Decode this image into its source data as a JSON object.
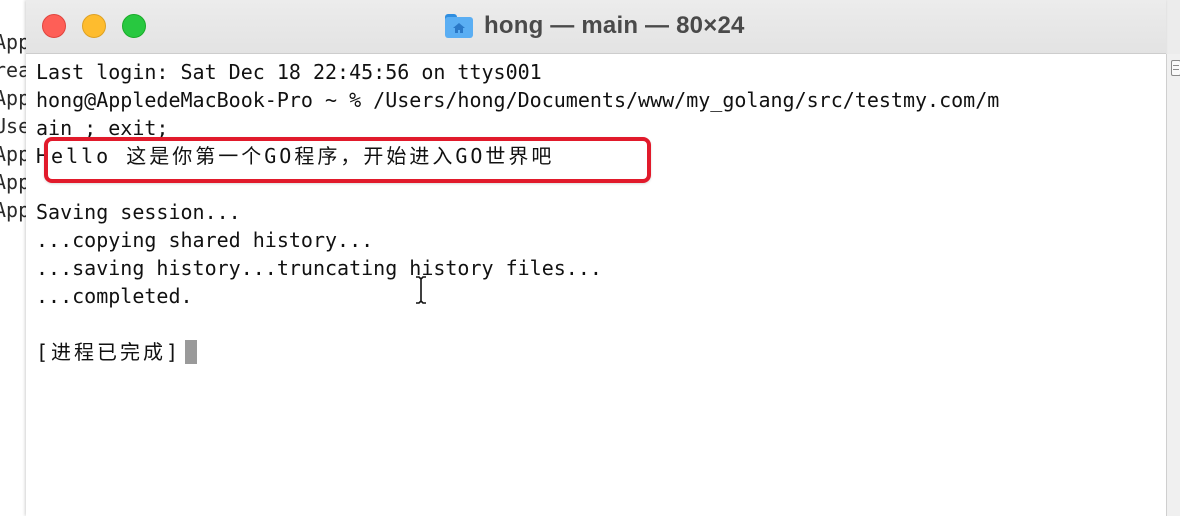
{
  "background": {
    "left_window_lines": [
      "App",
      "rea",
      "App",
      "Use",
      "App",
      "App",
      "App"
    ]
  },
  "window": {
    "title": "hong — main — 80×24",
    "title_icon": "home-folder-icon",
    "traffic_lights": {
      "close": "#fe5f57",
      "minimize": "#febc2e",
      "zoom": "#28c840"
    }
  },
  "terminal": {
    "lines": [
      "Last login: Sat Dec 18 22:45:56 on ttys001",
      "hong@AppledeMacBook-Pro ~ % /Users/hong/Documents/www/my_golang/src/testmy.com/m",
      "ain ; exit;",
      "Hello 这是你第一个GO程序，开始进入GO世界吧",
      "",
      "Saving session...",
      "...copying shared history...",
      "...saving history...truncating history files...",
      "...completed.",
      "",
      "[进程已完成]"
    ],
    "highlight_color": "#e11a2b",
    "cursor_color": "#9a9a9a"
  }
}
